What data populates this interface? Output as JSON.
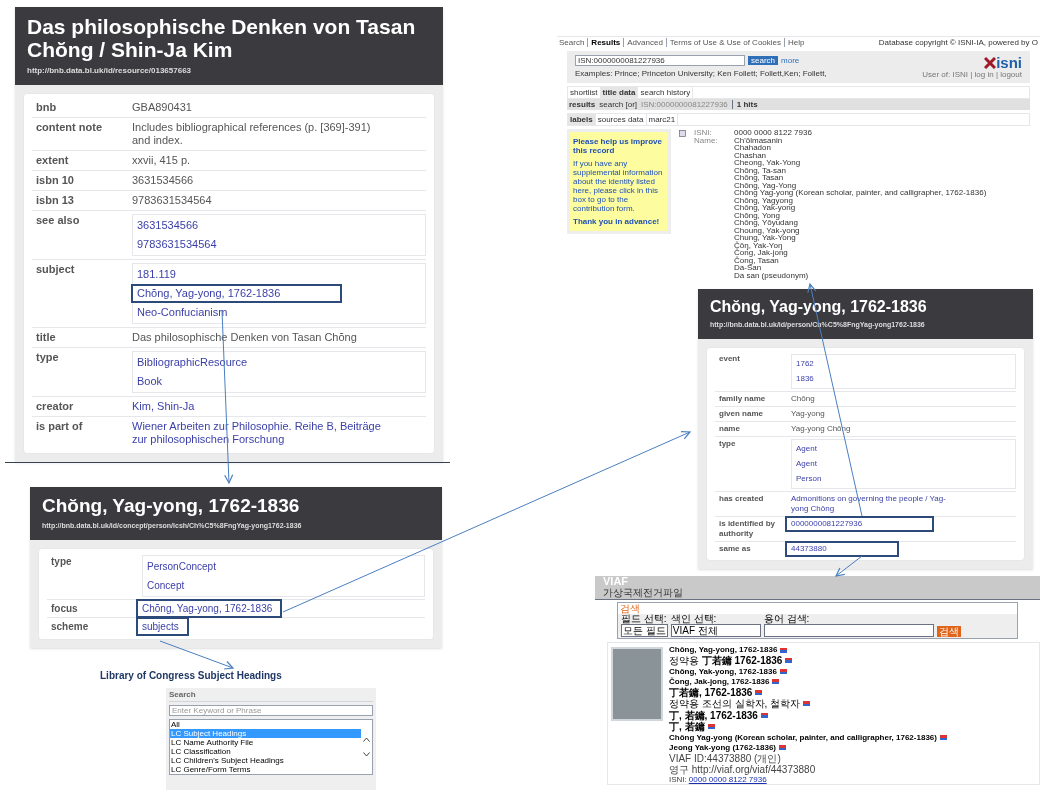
{
  "resource_record": {
    "title": "Das philosophische Denken von Tasan Chŏng / Shin-Ja Kim",
    "uri": "http://bnb.data.bl.uk/id/resource/013657663",
    "rows": [
      {
        "label": "bnb",
        "kind": "text",
        "values": [
          {
            "text": "GBA890431",
            "highlighted": false
          }
        ]
      },
      {
        "label": "content note",
        "kind": "text",
        "values": [
          {
            "text": "Includes bibliographical references (p. [369]-391) and index.",
            "highlighted": false
          }
        ]
      },
      {
        "label": "extent",
        "kind": "text",
        "values": [
          {
            "text": "xxvii, 415 p.",
            "highlighted": false
          }
        ]
      },
      {
        "label": "isbn 10",
        "kind": "text",
        "values": [
          {
            "text": "3631534566",
            "highlighted": false
          }
        ]
      },
      {
        "label": "isbn 13",
        "kind": "text",
        "values": [
          {
            "text": "9783631534564",
            "highlighted": false
          }
        ]
      },
      {
        "label": "see also",
        "kind": "links",
        "values": [
          {
            "text": "3631534566",
            "highlighted": false
          },
          {
            "text": "9783631534564",
            "highlighted": false
          }
        ]
      },
      {
        "label": "subject",
        "kind": "links",
        "values": [
          {
            "text": "181.119",
            "highlighted": false
          },
          {
            "text": "Chŏng, Yag-yong, 1762-1836",
            "highlighted": true
          },
          {
            "text": "Neo-Confucianism",
            "highlighted": false
          }
        ]
      },
      {
        "label": "title",
        "kind": "text",
        "values": [
          {
            "text": "Das philosophische Denken von Tasan Chŏng",
            "highlighted": false
          }
        ]
      },
      {
        "label": "type",
        "kind": "links",
        "values": [
          {
            "text": "BibliographicResource",
            "highlighted": false
          },
          {
            "text": "Book",
            "highlighted": false
          }
        ]
      },
      {
        "label": "creator",
        "kind": "link",
        "values": [
          {
            "text": "Kim, Shin-Ja",
            "highlighted": false
          }
        ]
      },
      {
        "label": "is part of",
        "kind": "link",
        "values": [
          {
            "text": "Wiener Arbeiten zur Philosophie. Reihe B, Beiträge zur philosophischen Forschung",
            "highlighted": false
          }
        ]
      }
    ]
  },
  "concept_record": {
    "title": "Chŏng, Yag-yong, 1762-1836",
    "uri": "http://bnb.data.bl.uk/id/concept/person/lcsh/Ch%C5%8FngYag-yong1762-1836",
    "rows": [
      {
        "label": "type",
        "kind": "links",
        "values": [
          {
            "text": "PersonConcept",
            "highlighted": false
          },
          {
            "text": "Concept",
            "highlighted": false
          }
        ]
      },
      {
        "label": "focus",
        "kind": "link",
        "values": [
          {
            "text": "Chŏng, Yag-yong, 1762-1836",
            "highlighted": true
          }
        ]
      },
      {
        "label": "scheme",
        "kind": "link",
        "values": [
          {
            "text": "subjects",
            "highlighted": true
          }
        ]
      }
    ]
  },
  "caption": "Library of Congress Subject Headings",
  "lcsh_search": {
    "title": "Search",
    "placeholder": "Enter Keyword or Phrase",
    "options": [
      {
        "label": "All",
        "selected": false
      },
      {
        "label": "LC Subject Headings",
        "selected": true
      },
      {
        "label": "LC Name Authority File",
        "selected": false
      },
      {
        "label": "LC Classification",
        "selected": false
      },
      {
        "label": "LC Children's Subject Headings",
        "selected": false
      },
      {
        "label": "LC Genre/Form Terms",
        "selected": false
      }
    ]
  },
  "isni": {
    "nav": [
      {
        "label": "Search",
        "selected": false
      },
      {
        "label": "Results",
        "selected": true
      },
      {
        "label": "Advanced",
        "selected": false
      },
      {
        "label": "Terms of Use & Use of Cookies",
        "selected": false
      },
      {
        "label": "Help",
        "selected": false
      }
    ],
    "copyright": "Database copyright © ISNI-IA, powered by O",
    "search_value": "ISN:0000000081227936",
    "search_button": "search",
    "more": "more",
    "examples": "Examples: Prince; Princeton University; Ken Follett; Follett,Ken; Follett,",
    "logo": "isni",
    "user_links": "User of: ISNI | log in | logout",
    "tabs": [
      {
        "label": "shortlist",
        "selected": false
      },
      {
        "label": "title data",
        "selected": true
      },
      {
        "label": "search history",
        "selected": false
      }
    ],
    "results_label": "results",
    "results_mode": "search [or]",
    "results_query": "ISN:0000000081227936",
    "results_count": "1 hits",
    "subtabs": [
      {
        "label": "labels",
        "selected": true
      },
      {
        "label": "sources data",
        "selected": false
      },
      {
        "label": "marc21",
        "selected": false
      }
    ],
    "notice": {
      "title": "Please help us improve this record",
      "body": "If you have any supplemental information about the identity listed here, please click in this box to go to the contribution form.",
      "thanks": "Thank you in advance!"
    },
    "isni_label": "ISNI:",
    "isni_value": "0000 0000 8122 7936",
    "name_label": "Name:",
    "names": [
      "Ch'ŏlmasanin",
      "Chahadon",
      "Chashan",
      "Cheong, Yak-Yong",
      "Chŏng, Ta-san",
      "Chŏng, Tasan",
      "Chŏng, Yag-Yong",
      "Chŏng Yag-yong (Korean scholar, painter, and calligrapher, 1762-1836)",
      "Chŏng, Yagyong",
      "Chŏng, Yak-yong",
      "Chŏng, Yong",
      "Chŏng, Yŏyudang",
      "Choung, Yak-yong",
      "Chung, Yak-Yong",
      "Čŏŋ, Yak-Yoŋ",
      "Čong, Jak-jong",
      "Čong, Tasan",
      "Da-San",
      "Da san (pseudonym)"
    ]
  },
  "person_record": {
    "title": "Chŏng, Yag-yong, 1762-1836",
    "uri": "http://bnb.data.bl.uk/id/person/Ch%C5%8FngYag-yong1762-1836",
    "rows": [
      {
        "label": "event",
        "kind": "links",
        "values": [
          {
            "text": "1762",
            "highlighted": false
          },
          {
            "text": "1836",
            "highlighted": false
          }
        ]
      },
      {
        "label": "family name",
        "kind": "text",
        "values": [
          {
            "text": "Chŏng",
            "highlighted": false
          }
        ]
      },
      {
        "label": "given name",
        "kind": "text",
        "values": [
          {
            "text": "Yag-yong",
            "highlighted": false
          }
        ]
      },
      {
        "label": "name",
        "kind": "text",
        "values": [
          {
            "text": "Yag-yong Chŏng",
            "highlighted": false
          }
        ]
      },
      {
        "label": "type",
        "kind": "links",
        "values": [
          {
            "text": "Agent",
            "highlighted": false
          },
          {
            "text": "Agent",
            "highlighted": false
          },
          {
            "text": "Person",
            "highlighted": false
          }
        ]
      },
      {
        "label": "has created",
        "kind": "link",
        "values": [
          {
            "text": "Admonitions on governing the people / Yag-yong Chŏng",
            "highlighted": false
          }
        ]
      },
      {
        "label": "is identified by authority",
        "kind": "link",
        "values": [
          {
            "text": "0000000081227936",
            "highlighted": true
          }
        ]
      },
      {
        "label": "same as",
        "kind": "link",
        "values": [
          {
            "text": "44373880",
            "highlighted": true
          }
        ]
      }
    ]
  },
  "viaf": {
    "logo": "VIAF",
    "subtitle": "가상국제전거파일",
    "search_title": "검색",
    "field_label": "필드 선택:",
    "field_value": "모든 필드",
    "index_label": "색인 선택:",
    "index_value": "VIAF 전체",
    "term_label": "용어 검색:",
    "search_button": "검색",
    "lines": [
      {
        "kind": "name",
        "text": "Chŏng, Yag-yong, 1762-1836"
      },
      {
        "kind": "variant",
        "text": "정약용 **丁若鏞 1762-1836**"
      },
      {
        "kind": "name",
        "text": "Chŏng, Yak-yong, 1762-1836"
      },
      {
        "kind": "name",
        "text": "Čong, Jak-jong, 1762-1836"
      },
      {
        "kind": "cjk",
        "text": "丁若鏞, 1762-1836"
      },
      {
        "kind": "variant",
        "text": "정약용 조선의 실학자, 철학자"
      },
      {
        "kind": "cjk",
        "text": "丁, 若鏞, 1762-1836"
      },
      {
        "kind": "cjk",
        "text": "丁, 若鏞"
      },
      {
        "kind": "name",
        "text": "Chŏng Yag-yong (Korean scholar, painter, and calligrapher, 1762-1836)"
      },
      {
        "kind": "name",
        "text": "Jeong Yak-yong (1762-1836)"
      },
      {
        "kind": "meta",
        "text": "VIAF ID:44373880 (개인)"
      },
      {
        "kind": "meta",
        "text": "영구 http://viaf.org/viaf/44373880"
      }
    ],
    "isni_label": "ISNI:",
    "isni_link": "0000 0000 8122 7936"
  }
}
